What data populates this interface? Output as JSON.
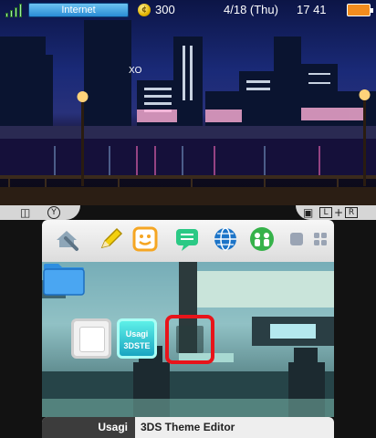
{
  "top_screen": {
    "status_bar": {
      "connection_label": "Internet",
      "coins": "300",
      "coin_icon": "coin-icon",
      "date": "4/18 (Thu)",
      "time": "17 41",
      "battery_icon": "battery-icon",
      "battery_color": "#f28c1e"
    },
    "wallpaper_sign": "XO"
  },
  "bottom_screen": {
    "toolbar_left_icons": [
      "camera-swap-icon",
      "y-button-icon"
    ],
    "toolbar_left_y": "Y",
    "toolbar_right_icons": [
      "camera-icon",
      "l-button-icon",
      "r-button-icon"
    ],
    "toolbar_right_l": "L",
    "toolbar_right_r": "R",
    "menu_icons": [
      "settings-wrench-icon",
      "notes-pencil-icon",
      "friends-face-icon",
      "notifications-icon",
      "internet-browser-icon",
      "miiverse-icon",
      "layout-view-icon",
      "grid-view-icon"
    ],
    "tiles": {
      "usagi_line1": "Usagi",
      "usagi_line2": "3DSTE"
    },
    "bottom_bar": {
      "app_name": "Usagi",
      "title": "3DS Theme Editor"
    },
    "accent_colors": {
      "selection": "#e8141a",
      "notes": "#f3d00f",
      "friends": "#f5a623",
      "notifications": "#2bc985",
      "browser": "#1c74c8",
      "miiverse": "#36b24a"
    }
  }
}
